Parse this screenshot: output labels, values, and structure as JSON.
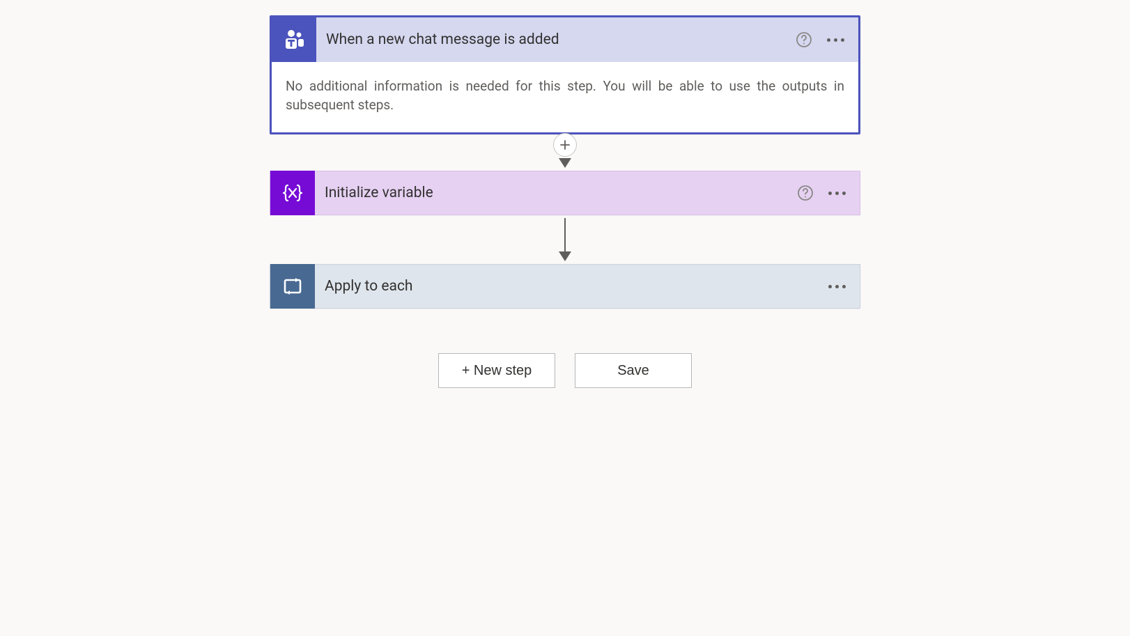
{
  "trigger": {
    "title": "When a new chat message is added",
    "body": "No additional information is needed for this step. You will be able to use the outputs in subsequent steps."
  },
  "steps": [
    {
      "title": "Initialize variable"
    },
    {
      "title": "Apply to each"
    }
  ],
  "buttons": {
    "new_step": "+ New step",
    "save": "Save"
  }
}
